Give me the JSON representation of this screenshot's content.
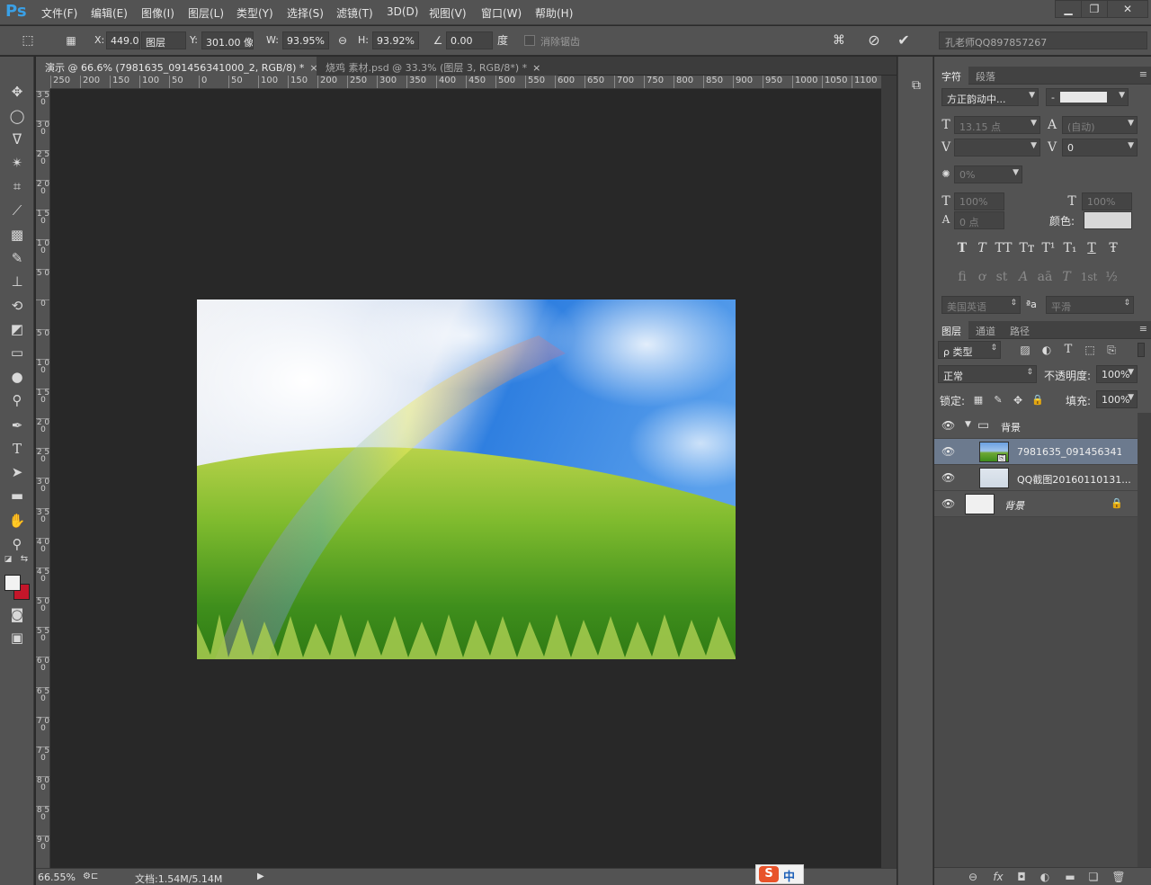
{
  "app": {
    "logo": "Ps"
  },
  "menu": [
    "文件(F)",
    "编辑(E)",
    "图像(I)",
    "图层(L)",
    "类型(Y)",
    "选择(S)",
    "滤镜(T)",
    "3D(D)",
    "视图(V)",
    "窗口(W)",
    "帮助(H)"
  ],
  "window_controls": {
    "minimize": "▁",
    "restore": "❐",
    "close": "✕"
  },
  "options": {
    "x_label": "X:",
    "x_value": "449.0(",
    "ref_label": "图层",
    "y_label": "Y:",
    "y_value": "301.00 像",
    "w_label": "W:",
    "w_value": "93.95%",
    "h_label": "H:",
    "h_value": "93.92%",
    "angle_value": "0.00",
    "angle_unit": "度",
    "antialias_label": "消除锯齿",
    "workspace": "孔老师QQ897857267"
  },
  "tabs": [
    {
      "label": "演示 @ 66.6% (7981635_091456341000_2, RGB/8) *",
      "close": "×"
    },
    {
      "label": "烧鸡 素材.psd @ 33.3% (图层 3, RGB/8*) *",
      "close": "×"
    }
  ],
  "ruler_h": [
    "250",
    "200",
    "150",
    "100",
    "50",
    "0",
    "50",
    "100",
    "150",
    "200",
    "250",
    "300",
    "350",
    "400",
    "450",
    "500",
    "550",
    "600",
    "650",
    "700",
    "750",
    "800",
    "850",
    "900",
    "950",
    "1000",
    "1050",
    "1100"
  ],
  "ruler_v": [
    "3 5 0",
    "3 0 0",
    "2 5 0",
    "2 0 0",
    "1 5 0",
    "1 0 0",
    "5 0",
    "0",
    "5 0",
    "1 0 0",
    "1 5 0",
    "2 0 0",
    "2 5 0",
    "3 0 0",
    "3 5 0",
    "4 0 0",
    "4 5 0",
    "5 0 0",
    "5 5 0",
    "6 0 0",
    "6 5 0",
    "7 0 0",
    "7 5 0",
    "8 0 0",
    "8 5 0",
    "9 0 0"
  ],
  "status": {
    "zoom": "66.55%",
    "doc": "文档:1.54M/5.14M"
  },
  "character": {
    "tabs": [
      "字符",
      "段落"
    ],
    "font_family": "方正韵动中...",
    "font_style": "-",
    "font_size": "13.15 点",
    "leading": "(自动)",
    "kerning": "",
    "tracking": "0",
    "tsume": "0%",
    "v_scale": "100%",
    "h_scale": "100%",
    "baseline": "0 点",
    "color_label": "颜色:",
    "style_buttons": [
      "T",
      "T",
      "TT",
      "Tт",
      "T¹",
      "T₁",
      "T",
      "Ŧ"
    ],
    "opentype_buttons": [
      "fi",
      "ơ",
      "st",
      "A",
      "aā",
      "T",
      "1st",
      "½"
    ],
    "language": "美国英语",
    "aa_label": "ªa",
    "aa_method": "平滑"
  },
  "layers": {
    "tabs": [
      "图层",
      "通道",
      "路径"
    ],
    "filter": "ρ 类型",
    "blend_mode": "正常",
    "opacity_label": "不透明度:",
    "opacity": "100%",
    "lock_label": "锁定:",
    "fill_label": "填充:",
    "fill": "100%",
    "items": [
      {
        "name": "背景",
        "type": "group"
      },
      {
        "name": "7981635_091456341...",
        "type": "smart",
        "selected": true
      },
      {
        "name": "QQ截图20160110131...",
        "type": "pixel"
      },
      {
        "name": "背景",
        "type": "background",
        "locked": true
      }
    ],
    "bottom_icons": [
      "link-icon",
      "fx-icon",
      "mask-icon",
      "adjustment-icon",
      "folder-icon",
      "new-layer-icon",
      "trash-icon"
    ],
    "bottom_glyphs": [
      "⊖",
      "fx",
      "◘",
      "◐",
      "▬",
      "❏",
      "🗑"
    ]
  },
  "ime": {
    "label": "中"
  }
}
